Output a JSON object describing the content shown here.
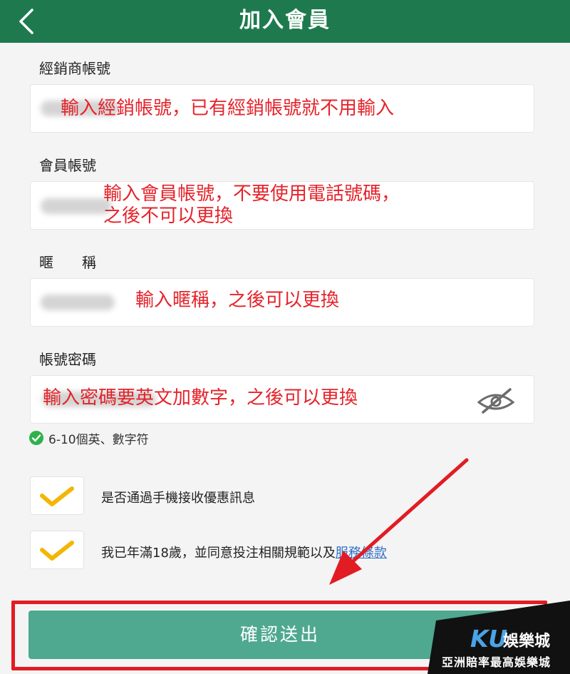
{
  "header": {
    "title": "加入會員",
    "back_icon": "chevron-left-icon"
  },
  "fields": {
    "agent_account": {
      "label": "經銷商帳號",
      "hint": "輸入經銷帳號，已有經銷帳號就不用輸入"
    },
    "member_account": {
      "label": "會員帳號",
      "hint_line1": "輸入會員帳號，不要使用電話號碼，",
      "hint_line2": "之後不可以更換"
    },
    "nickname": {
      "label": "暱　　稱",
      "hint": "輸入暱稱，之後可以更換"
    },
    "password": {
      "label": "帳號密碼",
      "hint": "輸入密碼要英文加數字，之後可以更換",
      "toggle_icon": "eye-off-icon"
    }
  },
  "password_rule": {
    "text": "6-10個英、數字符",
    "icon": "check-circle-icon",
    "color": "#2fb24a"
  },
  "options": {
    "promo": {
      "label": "是否通過手機接收優惠訊息",
      "checked": true
    },
    "age": {
      "label_prefix": "我已年滿18歲，並同意投注相關規範以及",
      "link_text": "服務條款",
      "checked": true
    }
  },
  "submit": {
    "label": "確認送出"
  },
  "watermark": {
    "logo": "KU",
    "brand": "娛樂城",
    "slogan": "亞洲賠率最高娛樂城"
  },
  "colors": {
    "header": "#1e7a4e",
    "button": "#4fa890",
    "hint": "#e5232a",
    "check": "#f2b705",
    "link": "#2f6ec5",
    "annotation": "#e21c23"
  }
}
